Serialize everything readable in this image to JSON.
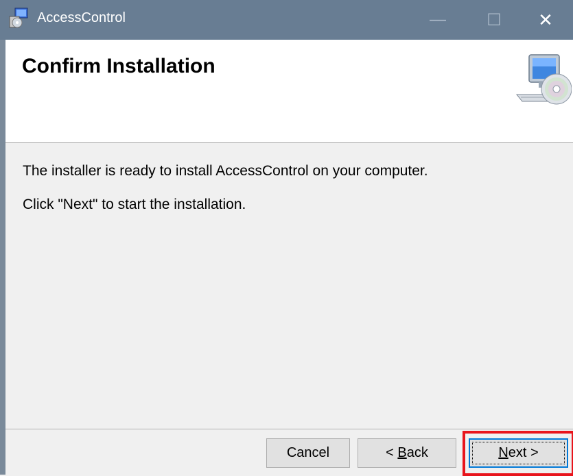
{
  "window": {
    "title": "AccessControl",
    "minimize_symbol": "—",
    "maximize_symbol": "☐",
    "close_symbol": "✕"
  },
  "header": {
    "title": "Confirm Installation",
    "icon": "computer-cd-icon"
  },
  "body": {
    "line1": "The installer is ready to install AccessControl on your computer.",
    "line2": "Click \"Next\" to start the installation."
  },
  "buttons": {
    "cancel": "Cancel",
    "back_prefix": "< ",
    "back_mnemonic": "B",
    "back_rest": "ack",
    "next_mnemonic": "N",
    "next_rest": "ext >"
  },
  "colors": {
    "titlebar": "#687d93",
    "highlight": "#e8141c",
    "focus": "#0078d7"
  }
}
